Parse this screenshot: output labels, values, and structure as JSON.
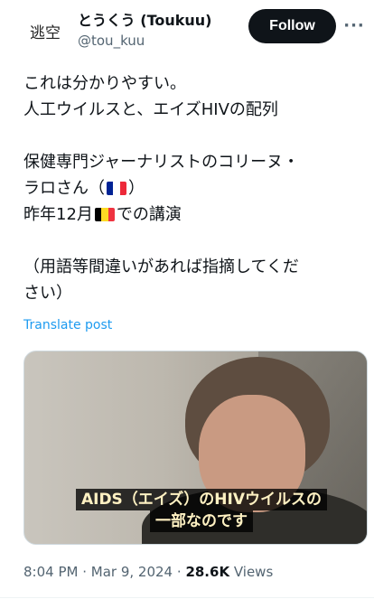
{
  "author": {
    "avatar_text": "逃空",
    "display_name": "とうくう (Toukuu)",
    "handle": "@tou_kuu"
  },
  "follow_label": "Follow",
  "more_icon": "more-horizontal-icon",
  "post": {
    "line1": "これは分かりやすい。",
    "line2": "人工ウイルスと、エイズHIVの配列",
    "line3": "保健専門ジャーナリストのコリーヌ・",
    "line4a": "ラロさん（",
    "line4b": "）",
    "line5a": "昨年12月",
    "line5b": "での講演",
    "line6": "（用語等間違いがあれば指摘してくだ",
    "line7": "さい）",
    "flags": {
      "france": [
        "#002395",
        "#ffffff",
        "#ed2939"
      ],
      "belgium": [
        "#000000",
        "#fdda24",
        "#ef3340"
      ]
    }
  },
  "translate_label": "Translate post",
  "media": {
    "caption_line1": "AIDS（エイズ）のHIVウイルスの",
    "caption_line2": "一部なのです"
  },
  "meta": {
    "time": "8:04 PM",
    "date": "Mar 9, 2024",
    "views_count": "28.6K",
    "views_label": "Views"
  }
}
